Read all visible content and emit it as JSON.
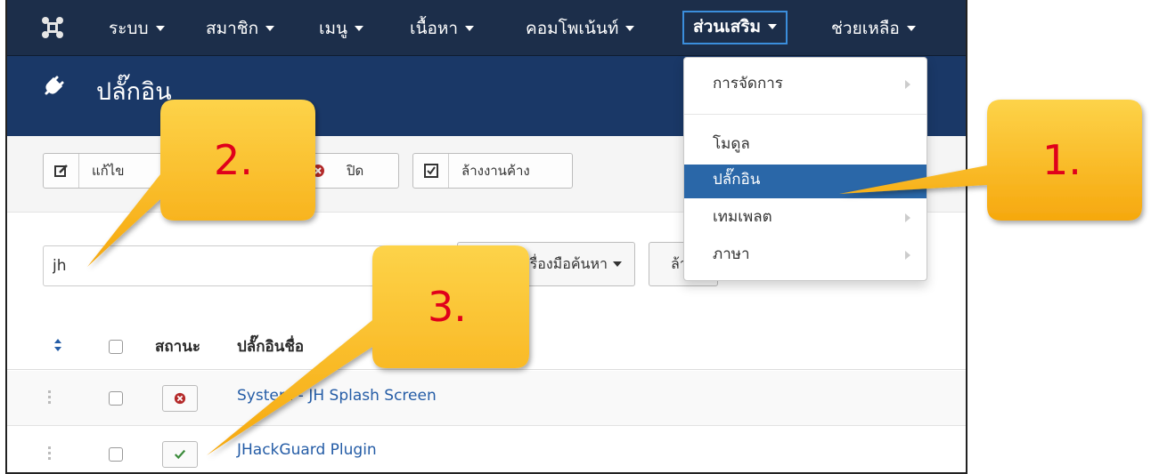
{
  "navbar": {
    "logo_icon": "joomla-logo-icon",
    "items": [
      {
        "label": "ระบบ"
      },
      {
        "label": "สมาชิก"
      },
      {
        "label": "เมนู"
      },
      {
        "label": "เนื้อหา"
      },
      {
        "label": "คอมโพเน้นท์"
      },
      {
        "label": "ส่วนเสริม"
      },
      {
        "label": "ช่วยเหลือ"
      }
    ]
  },
  "subhead": {
    "icon": "plug-icon",
    "title": "ปลั๊กอิน"
  },
  "toolbar": {
    "edit_label": "แก้ไข",
    "disable_label": "ปิด",
    "checkin_label": "ล้างงานค้าง"
  },
  "search": {
    "value": "jh",
    "tools_label": "เครื่องมือค้นหา",
    "clear_label": "ล้าง"
  },
  "table": {
    "headers": {
      "status": "สถานะ",
      "name": "ปลั๊กอินชื่อ"
    },
    "rows": [
      {
        "name": "System - JH Splash Screen",
        "status": "disabled"
      },
      {
        "name": "JHackGuard Plugin",
        "status": "enabled"
      }
    ]
  },
  "dropdown": {
    "items": [
      {
        "label": "การจัดการ",
        "has_submenu": true
      },
      {
        "label": "โมดูล",
        "has_submenu": false
      },
      {
        "label": "ปลั๊กอิน",
        "has_submenu": false
      },
      {
        "label": "เทมเพลต",
        "has_submenu": true
      },
      {
        "label": "ภาษา",
        "has_submenu": true
      }
    ]
  },
  "callouts": [
    {
      "label": "1."
    },
    {
      "label": "2."
    },
    {
      "label": "3."
    }
  ],
  "colors": {
    "navbar": "#1c2e4a",
    "subhead": "#1a3867",
    "active_menu": "#2a67a8",
    "callout_fill": "#fbbf1e",
    "callout_text": "#e0001b",
    "link": "#245ca6"
  }
}
